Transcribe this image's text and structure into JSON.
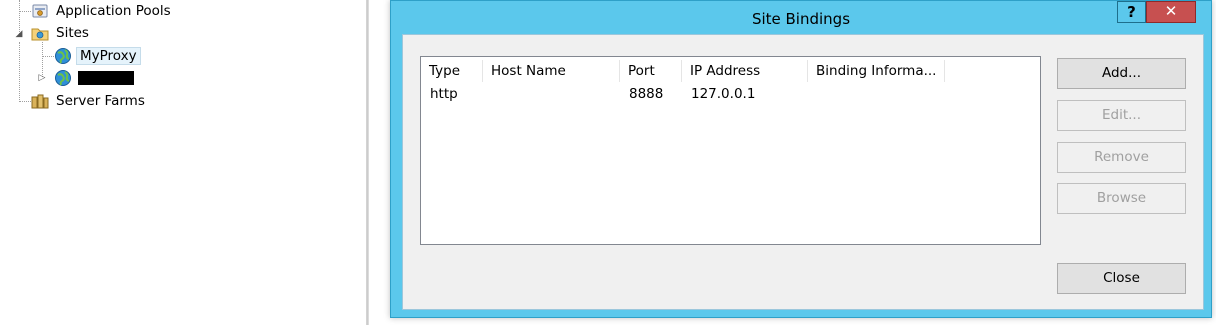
{
  "tree": {
    "items": [
      {
        "label": "Application Pools",
        "icon": "application-pools-icon"
      },
      {
        "label": "Sites",
        "icon": "sites-folder-icon",
        "expanded": true
      },
      {
        "label": "MyProxy",
        "icon": "globe-icon",
        "selected": true
      },
      {
        "label": "",
        "icon": "globe-icon",
        "redacted": true
      },
      {
        "label": "Server Farms",
        "icon": "server-farms-icon"
      }
    ]
  },
  "dialog": {
    "title": "Site Bindings",
    "help_label": "?",
    "close_x_label": "x",
    "columns": [
      "Type",
      "Host Name",
      "Port",
      "IP Address",
      "Binding Informa..."
    ],
    "rows": [
      {
        "type": "http",
        "host_name": "",
        "port": "8888",
        "ip_address": "127.0.0.1",
        "binding_info": ""
      }
    ],
    "buttons": {
      "add": "Add...",
      "edit": "Edit...",
      "remove": "Remove",
      "browse": "Browse",
      "close": "Close"
    }
  },
  "colors": {
    "dialog_frame": "#5bc8ec",
    "close_x": "#c75050",
    "client": "#f0f0f0"
  }
}
